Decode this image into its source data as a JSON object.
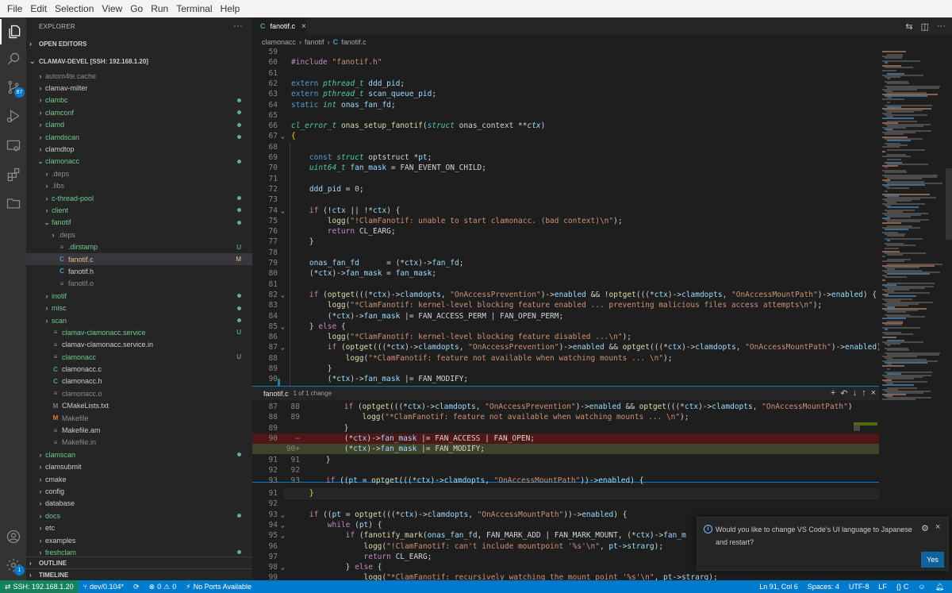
{
  "menu": [
    "File",
    "Edit",
    "Selection",
    "View",
    "Go",
    "Run",
    "Terminal",
    "Help"
  ],
  "activity": {
    "scm_badge": "87",
    "accounts_badge": "1"
  },
  "explorer": {
    "title": "EXPLORER",
    "more": "···",
    "open_editors": "OPEN EDITORS",
    "workspace": "CLAMAV-DEVEL [SSH: 192.168.1.20]",
    "outline": "OUTLINE",
    "timeline": "TIMELINE",
    "tree": [
      {
        "name": "autom4te.cache",
        "indent": 1,
        "type": "folder",
        "color": "dim"
      },
      {
        "name": "clamav-milter",
        "indent": 1,
        "type": "folder",
        "color": "def"
      },
      {
        "name": "clambc",
        "indent": 1,
        "type": "folder",
        "color": "green",
        "dot": true
      },
      {
        "name": "clamconf",
        "indent": 1,
        "type": "folder",
        "color": "green",
        "dot": true
      },
      {
        "name": "clamd",
        "indent": 1,
        "type": "folder",
        "color": "green",
        "dot": true
      },
      {
        "name": "clamdscan",
        "indent": 1,
        "type": "folder",
        "color": "green",
        "dot": true
      },
      {
        "name": "clamdtop",
        "indent": 1,
        "type": "folder",
        "color": "def"
      },
      {
        "name": "clamonacc",
        "indent": 1,
        "type": "folder-open",
        "color": "green",
        "dot": true
      },
      {
        "name": ".deps",
        "indent": 2,
        "type": "folder",
        "color": "dim"
      },
      {
        "name": ".libs",
        "indent": 2,
        "type": "folder",
        "color": "dim"
      },
      {
        "name": "c-thread-pool",
        "indent": 2,
        "type": "folder",
        "color": "green",
        "dot": true
      },
      {
        "name": "client",
        "indent": 2,
        "type": "folder",
        "color": "green",
        "dot": true
      },
      {
        "name": "fanotif",
        "indent": 2,
        "type": "folder-open",
        "color": "green",
        "dot": true
      },
      {
        "name": ".deps",
        "indent": 3,
        "type": "folder",
        "color": "dim"
      },
      {
        "name": ".dirstamp",
        "indent": 3,
        "type": "file",
        "icon": "≡",
        "color": "green",
        "dec": "U"
      },
      {
        "name": "fanotif.c",
        "indent": 3,
        "type": "file",
        "icon": "C",
        "color": "mod",
        "dec": "M",
        "selected": true
      },
      {
        "name": "fanotif.h",
        "indent": 3,
        "type": "file",
        "icon": "C",
        "color": "def"
      },
      {
        "name": "fanotif.o",
        "indent": 3,
        "type": "file",
        "icon": "≡",
        "color": "dim"
      },
      {
        "name": "inotif",
        "indent": 2,
        "type": "folder",
        "color": "green",
        "dot": true
      },
      {
        "name": "misc",
        "indent": 2,
        "type": "folder",
        "color": "green",
        "dot": true
      },
      {
        "name": "scan",
        "indent": 2,
        "type": "folder",
        "color": "green",
        "dot": true
      },
      {
        "name": "clamav-clamonacc.service",
        "indent": 2,
        "type": "file",
        "icon": "≡",
        "color": "green",
        "dec": "U"
      },
      {
        "name": "clamav-clamonacc.service.in",
        "indent": 2,
        "type": "file",
        "icon": "≡",
        "color": "def"
      },
      {
        "name": "clamonacc",
        "indent": 2,
        "type": "file",
        "icon": "≡",
        "color": "green",
        "dec": "U"
      },
      {
        "name": "clamonacc.c",
        "indent": 2,
        "type": "file",
        "icon": "C",
        "color": "def"
      },
      {
        "name": "clamonacc.h",
        "indent": 2,
        "type": "file",
        "icon": "C",
        "color": "def"
      },
      {
        "name": "clamonacc.o",
        "indent": 2,
        "type": "file",
        "icon": "≡",
        "color": "dim"
      },
      {
        "name": "CMakeLists.txt",
        "indent": 2,
        "type": "file",
        "icon": "M",
        "color": "def"
      },
      {
        "name": "Makefile",
        "indent": 2,
        "type": "file",
        "icon": "M",
        "color": "dim"
      },
      {
        "name": "Makefile.am",
        "indent": 2,
        "type": "file",
        "icon": "≡",
        "color": "def"
      },
      {
        "name": "Makefile.in",
        "indent": 2,
        "type": "file",
        "icon": "≡",
        "color": "dim"
      },
      {
        "name": "clamscan",
        "indent": 1,
        "type": "folder",
        "color": "green",
        "dot": true
      },
      {
        "name": "clamsubmit",
        "indent": 1,
        "type": "folder",
        "color": "def"
      },
      {
        "name": "cmake",
        "indent": 1,
        "type": "folder",
        "color": "def"
      },
      {
        "name": "config",
        "indent": 1,
        "type": "folder",
        "color": "def"
      },
      {
        "name": "database",
        "indent": 1,
        "type": "folder",
        "color": "def"
      },
      {
        "name": "docs",
        "indent": 1,
        "type": "folder",
        "color": "green",
        "dot": true
      },
      {
        "name": "etc",
        "indent": 1,
        "type": "folder",
        "color": "def"
      },
      {
        "name": "examples",
        "indent": 1,
        "type": "folder",
        "color": "def"
      },
      {
        "name": "freshclam",
        "indent": 1,
        "type": "folder",
        "color": "green",
        "dot": true
      },
      {
        "name": "fuzz",
        "indent": 1,
        "type": "folder",
        "color": "def"
      }
    ]
  },
  "editor": {
    "tab": "fanotif.c",
    "breadcrumb": [
      "clamonacc",
      "fanotif",
      "fanotif.c"
    ],
    "lines": [
      {
        "n": "59",
        "h": ""
      },
      {
        "n": "60",
        "h": "<span class='m'>#include</span> <span class='s'>\"fanotif.h\"</span>"
      },
      {
        "n": "61",
        "h": ""
      },
      {
        "n": "62",
        "h": "<span class='k'>extern</span> <span class='it'>pthread_t</span> <span class='v'>ddd_pid</span>;"
      },
      {
        "n": "63",
        "h": "<span class='k'>extern</span> <span class='it'>pthread_t</span> <span class='v'>scan_queue_pid</span>;"
      },
      {
        "n": "64",
        "h": "<span class='k'>static</span> <span class='it'>int</span> <span class='v'>onas_fan_fd</span>;"
      },
      {
        "n": "65",
        "h": ""
      },
      {
        "n": "66",
        "h": "<span class='it'>cl_error_t</span> <span class='f'>onas_setup_fanotif</span>(<span class='it'>struct</span> onas_context **<span class='v' style='font-style:italic'>ctx</span>)"
      },
      {
        "n": "67",
        "h": "<span style='color:#ffd700'>{</span>",
        "fold": "⌄"
      },
      {
        "n": "68",
        "h": ""
      },
      {
        "n": "69",
        "h": "    <span class='k'>const</span> <span class='it'>struct</span> optstruct *<span class='v'>pt</span>;"
      },
      {
        "n": "70",
        "h": "    <span class='it'>uint64_t</span> <span class='v'>fan_mask</span> = FAN_EVENT_ON_CHILD;"
      },
      {
        "n": "71",
        "h": ""
      },
      {
        "n": "72",
        "h": "    <span class='v'>ddd_pid</span> = <span class='n'>0</span>;"
      },
      {
        "n": "73",
        "h": ""
      },
      {
        "n": "74",
        "h": "    <span class='m'>if</span> (!<span class='v'>ctx</span> || !*<span class='v'>ctx</span>) {",
        "fold": "⌄"
      },
      {
        "n": "75",
        "h": "        <span class='f'>logg</span>(<span class='s'>\"!ClamFanotif: unable to start clamonacc. (bad context)\\n\"</span>);"
      },
      {
        "n": "76",
        "h": "        <span class='m'>return</span> CL_EARG;"
      },
      {
        "n": "77",
        "h": "    }"
      },
      {
        "n": "78",
        "h": ""
      },
      {
        "n": "79",
        "h": "    <span class='v'>onas_fan_fd</span>      = (*<span class='v'>ctx</span>)-><span class='v'>fan_fd</span>;"
      },
      {
        "n": "80",
        "h": "    (*<span class='v'>ctx</span>)-><span class='v'>fan_mask</span> = <span class='v'>fan_mask</span>;"
      },
      {
        "n": "81",
        "h": ""
      },
      {
        "n": "82",
        "h": "    <span class='m'>if</span> (<span class='f'>optget</span>(((*<span class='v'>ctx</span>)-><span class='v'>clamdopts</span>, <span class='s'>\"OnAccessPrevention\"</span>)-><span class='v'>enabled</span> && !<span class='f'>optget</span>(((*<span class='v'>ctx</span>)-><span class='v'>clamdopts</span>, <span class='s'>\"OnAccessMountPath\"</span>)-><span class='v'>enabled</span>) {",
        "fold": "⌄"
      },
      {
        "n": "83",
        "h": "        <span class='f'>logg</span>(<span class='s'>\"*ClamFanotif: kernel-level blocking feature enabled ... preventing malicious files access attempts\\n\"</span>);"
      },
      {
        "n": "84",
        "h": "        (*<span class='v'>ctx</span>)-><span class='v'>fan_mask</span> |= FAN_ACCESS_PERM | FAN_OPEN_PERM;"
      },
      {
        "n": "85",
        "h": "    } <span class='m'>else</span> {",
        "fold": "⌄"
      },
      {
        "n": "86",
        "h": "        <span class='f'>logg</span>(<span class='s'>\"*ClamFanotif: kernel-level blocking feature disabled ...\\n\"</span>);"
      },
      {
        "n": "87",
        "h": "        <span class='m'>if</span> (<span class='f'>optget</span>(((*<span class='v'>ctx</span>)-><span class='v'>clamdopts</span>, <span class='s'>\"OnAccessPrevention\"</span>)-><span class='v'>enabled</span> && <span class='f'>optget</span>(((*<span class='v'>ctx</span>)-><span class='v'>clamdopts</span>, <span class='s'>\"OnAccessMountPath\"</span>)-><span class='v'>enabled</span>)",
        "fold": "⌄"
      },
      {
        "n": "88",
        "h": "            <span class='f'>logg</span>(<span class='s'>\"*ClamFanotif: feature not available when watching mounts ... \\n\"</span>);"
      },
      {
        "n": "89",
        "h": "        }"
      },
      {
        "n": "90",
        "h": "        (*<span class='v'>ctx</span>)-><span class='v'>fan_mask</span> |= FAN_MODIFY;"
      }
    ],
    "peek": {
      "file": "fanotif.c",
      "changes": "1 of 1 change",
      "lines": [
        {
          "a": "87",
          "b": "88",
          "h": "        <span class='m'>if</span> (<span class='f'>optget</span>(((*<span class='v'>ctx</span>)-><span class='v'>clamdopts</span>, <span class='s'>\"OnAccessPrevention\"</span>)-><span class='v'>enabled</span> && <span class='f'>optget</span>(((*<span class='v'>ctx</span>)-><span class='v'>clamdopts</span>, <span class='s'>\"OnAccessMountPath\"</span>)"
        },
        {
          "a": "88",
          "b": "89",
          "h": "            <span class='f'>logg</span>(<span class='s'>\"*ClamFanotif: feature not available when watching mounts ... \\n\"</span>);"
        },
        {
          "a": "89",
          "b": "",
          "h": "        }"
        },
        {
          "a": "90",
          "b": "−",
          "h": "        (*<span class='v'>ctx</span>)-><span class='v'>fan_mask</span> |= FAN_ACCESS | FAN_OPEN;",
          "kind": "del"
        },
        {
          "a": "",
          "b": "90+",
          "h": "        (*<span class='v'>ctx</span>)-><span class='v'>fan_mask</span> |= FAN_MODIFY;",
          "kind": "add"
        },
        {
          "a": "91",
          "b": "91",
          "h": "    }"
        },
        {
          "a": "92",
          "b": "92",
          "h": ""
        },
        {
          "a": "93",
          "b": "93",
          "h": "    <span class='m'>if</span> ((<span class='v'>pt</span> = <span class='f'>optget</span>(((*<span class='v'>ctx</span>)-><span class='v'>clamdopts</span>, <span class='s'>\"OnAccessMountPath\"</span>))-><span class='v'>enabled</span>) {"
        }
      ]
    },
    "lines2": [
      {
        "n": "91",
        "h": "    <span style='color:#ffd700'>}</span>"
      },
      {
        "n": "92",
        "h": ""
      },
      {
        "n": "93",
        "h": "    <span class='m'>if</span> ((<span class='v'>pt</span> = <span class='f'>optget</span>(((*<span class='v'>ctx</span>)-><span class='v'>clamdopts</span>, <span class='s'>\"OnAccessMountPath\"</span>))-><span class='v'>enabled</span>) {",
        "fold": "⌄"
      },
      {
        "n": "94",
        "h": "        <span class='m'>while</span> (<span class='v'>pt</span>) {",
        "fold": "⌄"
      },
      {
        "n": "95",
        "h": "            <span class='m'>if</span> (<span class='f'>fanotify_mark</span>(<span class='v'>onas_fan_fd</span>, FAN_MARK_ADD | FAN_MARK_MOUNT, (*<span class='v'>ctx</span>)-><span class='v'>fan_m</span>",
        "fold": "⌄"
      },
      {
        "n": "96",
        "h": "                <span class='f'>logg</span>(<span class='s'>\"!ClamFanotif: can't include mountpoint '%s'\\n\"</span>, <span class='v'>pt</span>-><span class='v'>strarg</span>);"
      },
      {
        "n": "97",
        "h": "                <span class='m'>return</span> CL_EARG;"
      },
      {
        "n": "98",
        "h": "            } <span class='m'>else</span> {",
        "fold": "⌄"
      },
      {
        "n": "99",
        "h": "                <span class='f'>logg</span>(<span class='s'>\"*ClamFanotif: recursively watching the mount point '%s'\\n\"</span>, <span class='v'>pt</span>-><span class='v'>strarg</span>);"
      }
    ]
  },
  "notification": {
    "message": "Would you like to change VS Code's UI language to Japanese and restart?",
    "yes": "Yes"
  },
  "status": {
    "remote": "SSH: 192.168.1.20",
    "branch": "dev/0.104*",
    "errors": "0",
    "warnings": "0",
    "ports": "No Ports Available",
    "position": "Ln 91, Col 6",
    "spaces": "Spaces: 4",
    "encoding": "UTF-8",
    "eol": "LF",
    "language": "C"
  }
}
